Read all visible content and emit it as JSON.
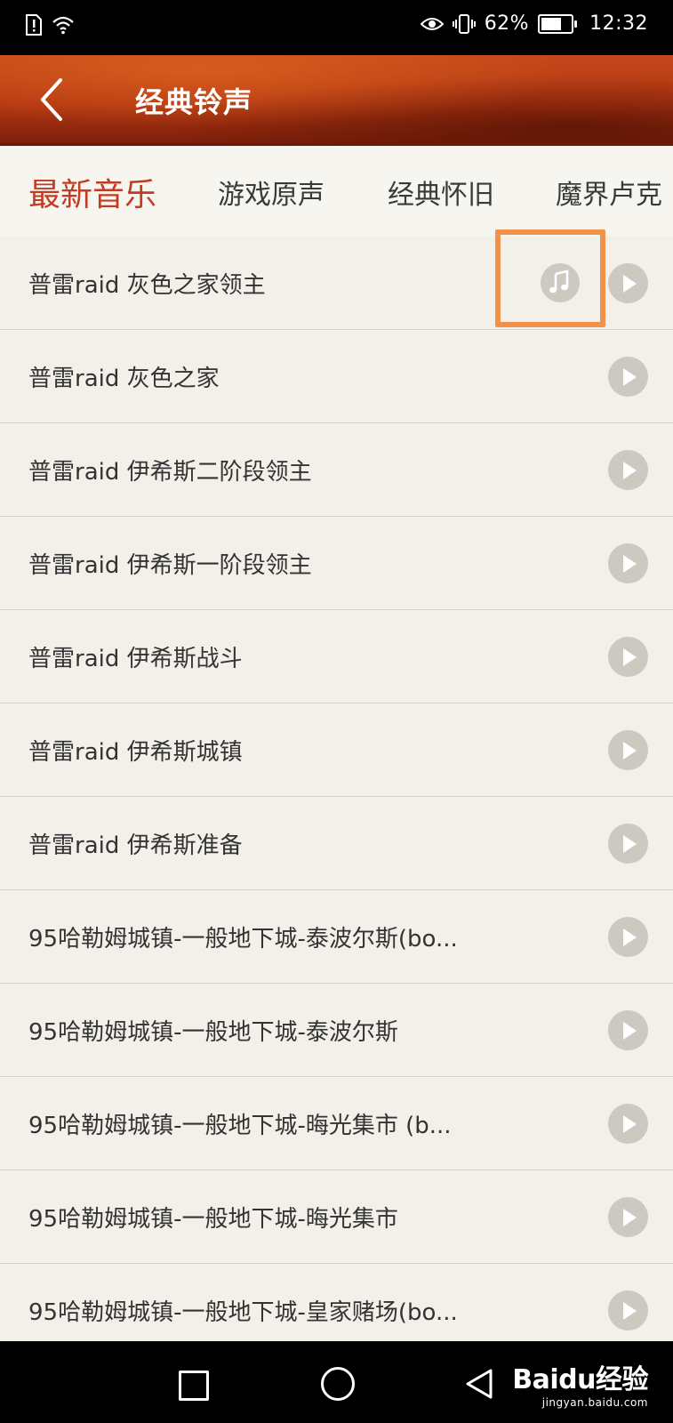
{
  "status_bar": {
    "battery": "62%",
    "time": "12:32"
  },
  "header": {
    "title": "经典铃声"
  },
  "tabs": [
    {
      "label": "最新音乐",
      "active": true
    },
    {
      "label": "游戏原声",
      "active": false
    },
    {
      "label": "经典怀旧",
      "active": false
    },
    {
      "label": "魔界卢克",
      "active": false
    }
  ],
  "songs": [
    {
      "title": "普雷raid 灰色之家领主",
      "has_ringtone_button": true
    },
    {
      "title": "普雷raid 灰色之家"
    },
    {
      "title": "普雷raid 伊希斯二阶段领主"
    },
    {
      "title": "普雷raid 伊希斯一阶段领主"
    },
    {
      "title": "普雷raid 伊希斯战斗"
    },
    {
      "title": "普雷raid 伊希斯城镇"
    },
    {
      "title": "普雷raid 伊希斯准备"
    },
    {
      "title": "95哈勒姆城镇-一般地下城-泰波尔斯(bo..."
    },
    {
      "title": "95哈勒姆城镇-一般地下城-泰波尔斯"
    },
    {
      "title": "95哈勒姆城镇-一般地下城-晦光集市 (b..."
    },
    {
      "title": "95哈勒姆城镇-一般地下城-晦光集市"
    },
    {
      "title": "95哈勒姆城镇-一般地下城-皇家赌场(bo..."
    }
  ],
  "watermark": {
    "logo": "Baidu经验",
    "url": "jingyan.baidu.com"
  },
  "icons": {
    "play": "play-icon",
    "ringtone": "music-note-icon",
    "back": "chevron-left-icon"
  },
  "colors": {
    "accent": "#c23b22",
    "highlight": "#f0924a",
    "header": "#b33612"
  }
}
